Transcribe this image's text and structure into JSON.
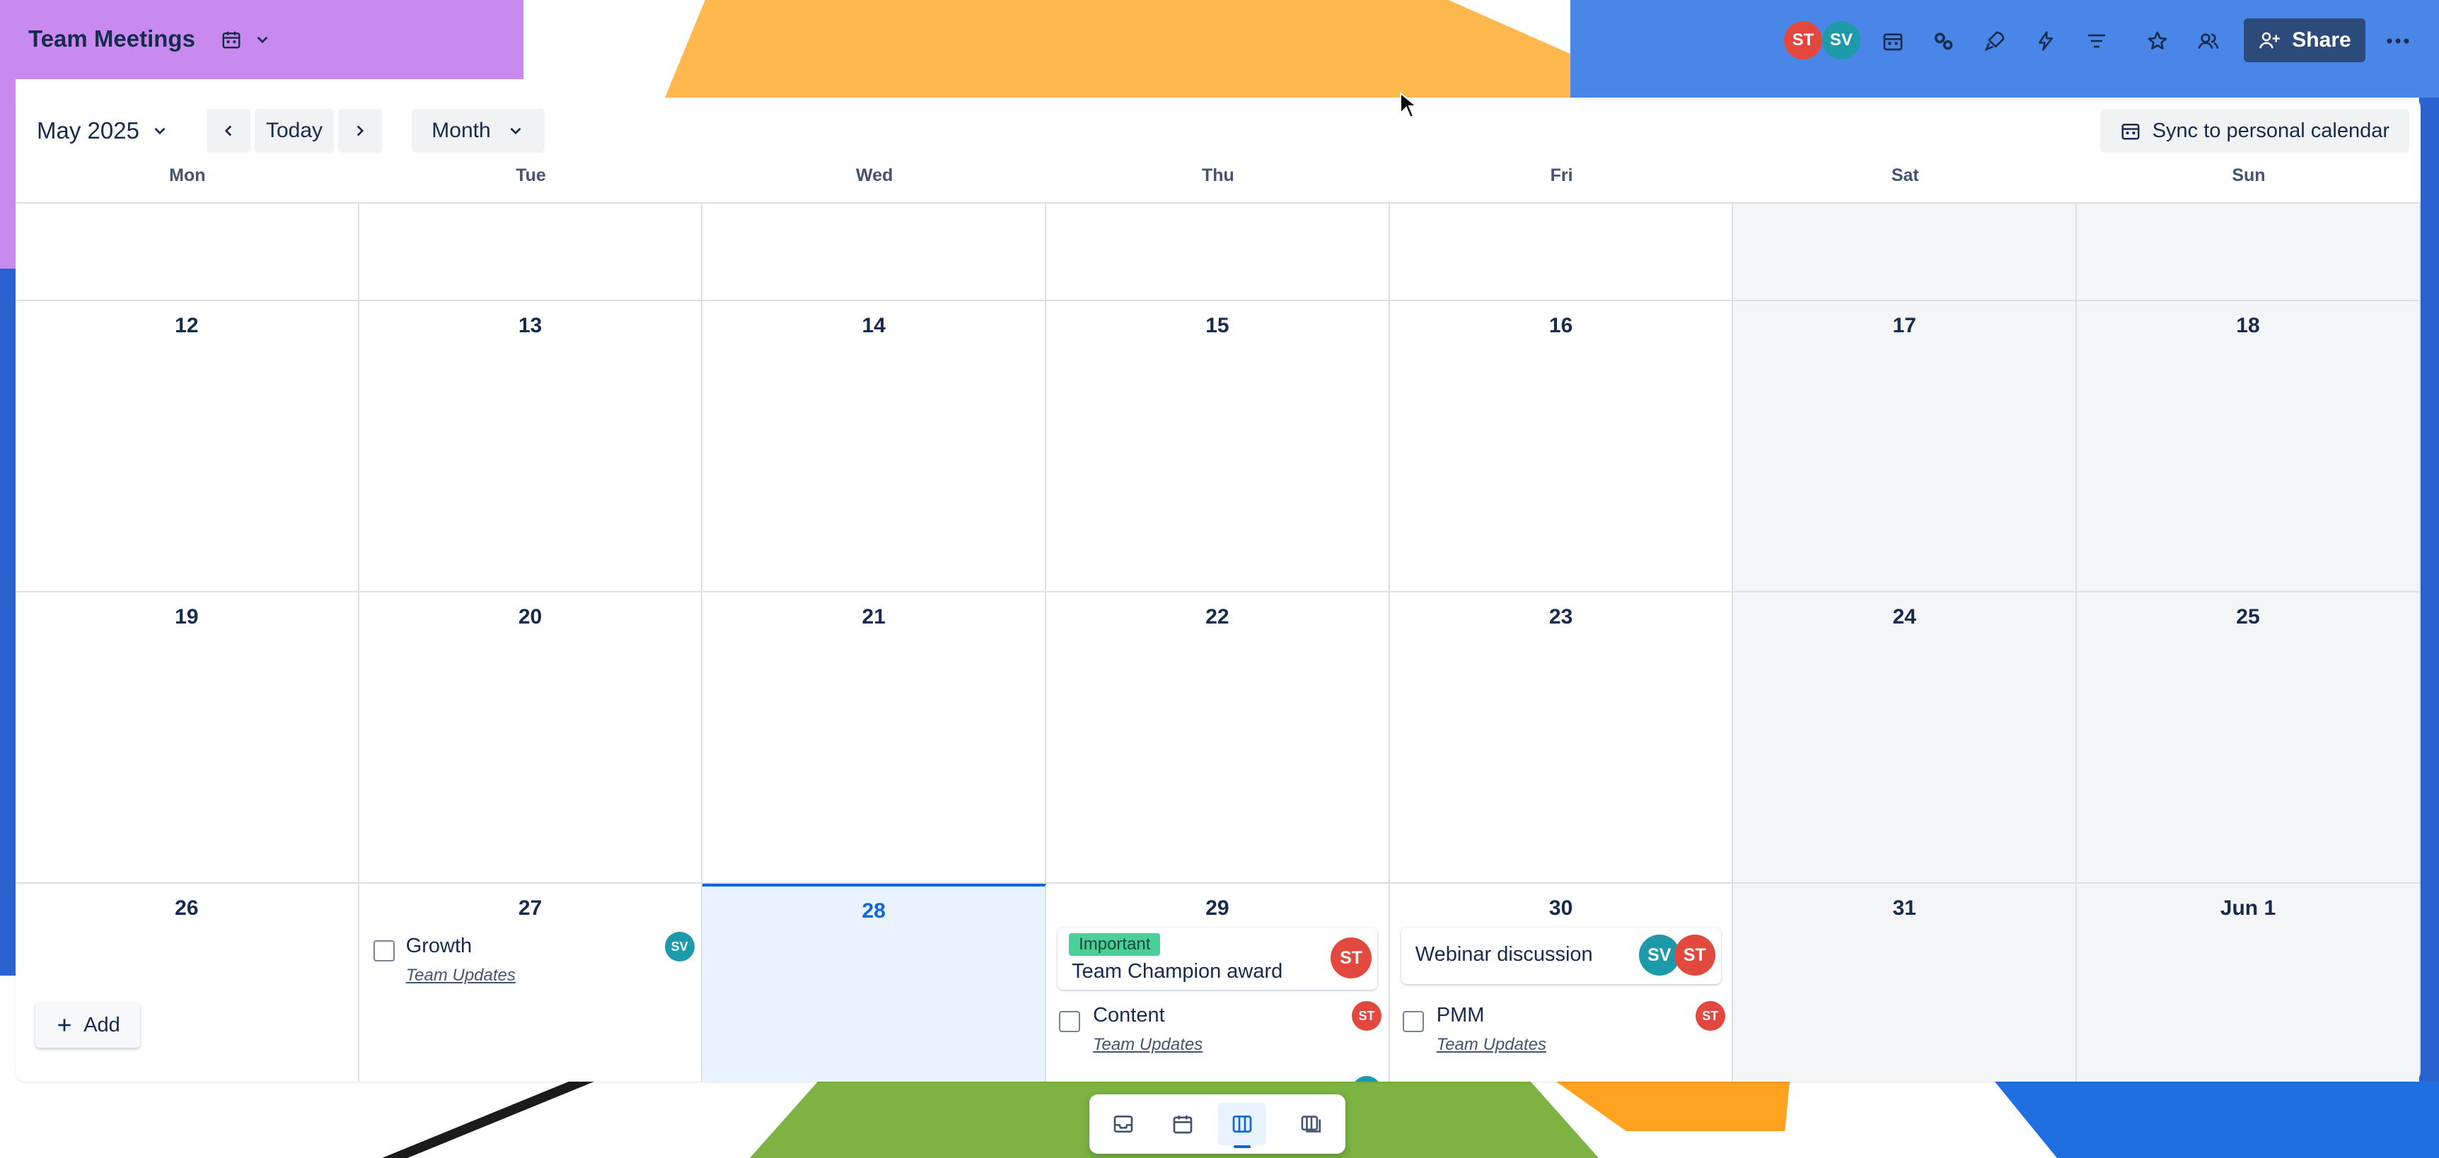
{
  "header": {
    "board_title": "Team Meetings",
    "share_label": "Share",
    "members": [
      {
        "initials": "ST",
        "color": "#e2483d"
      },
      {
        "initials": "SV",
        "color": "#1d9aaa"
      }
    ],
    "icons": [
      "calendar-icon",
      "automation-icon",
      "power-ups-icon",
      "lightning-icon",
      "filter-icon",
      "star-icon",
      "visibility-icon",
      "more-icon"
    ]
  },
  "toolbar": {
    "month_label": "May 2025",
    "today_label": "Today",
    "view_label": "Month",
    "sync_label": "Sync to personal calendar"
  },
  "weekdays": [
    "Mon",
    "Tue",
    "Wed",
    "Thu",
    "Fri",
    "Sat",
    "Sun"
  ],
  "weeks": [
    [
      "",
      "",
      "",
      "",
      "",
      "",
      ""
    ],
    [
      "12",
      "13",
      "14",
      "15",
      "16",
      "17",
      "18"
    ],
    [
      "19",
      "20",
      "21",
      "22",
      "23",
      "24",
      "25"
    ],
    [
      "26",
      "27",
      "28",
      "29",
      "30",
      "31",
      "Jun 1"
    ]
  ],
  "events": {
    "growth": {
      "title": "Growth",
      "list": "Team Updates",
      "member": "SV"
    },
    "champion": {
      "label": "Important",
      "title": "Team Champion award",
      "member": "ST"
    },
    "content": {
      "title": "Content",
      "list": "Team Updates",
      "member": "ST"
    },
    "webinar": {
      "title": "Webinar discussion",
      "members": [
        "SV",
        "ST"
      ]
    },
    "pmm": {
      "title": "PMM",
      "list": "Team Updates",
      "member": "ST"
    }
  },
  "add_label": "Add",
  "colors": {
    "accent": "#0c66e4",
    "share_bg": "#2c4a7a",
    "label_green": "#4bce97",
    "today_bg": "#e9f2ff"
  }
}
